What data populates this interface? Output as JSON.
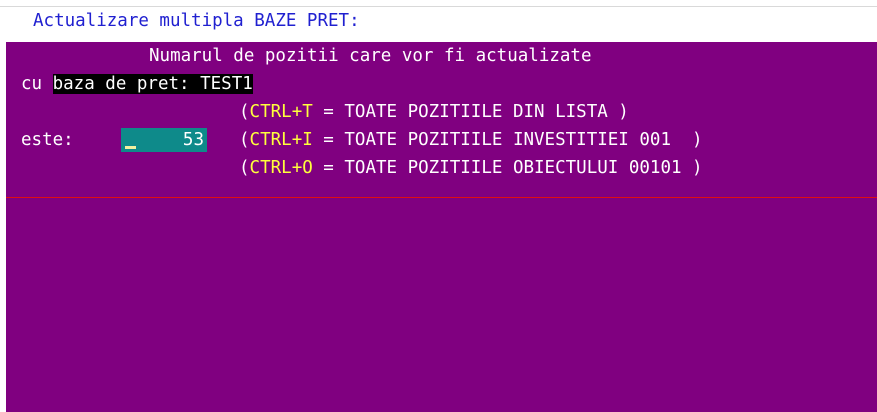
{
  "window": {
    "title": "Actualizare multipla BAZE PRET:"
  },
  "dialog": {
    "heading": "Numarul de pozitii care vor fi actualizate",
    "prefix_cu": "cu ",
    "base_label": "baza de pret: TEST1",
    "label_este": "este:",
    "count_value": "53",
    "options": [
      {
        "open": "(",
        "key": "CTRL+T",
        "rest": " = TOATE POZITIILE DIN LISTA )"
      },
      {
        "open": "(",
        "key": "CTRL+I",
        "rest": " = TOATE POZITIILE INVESTITIEI 001  )"
      },
      {
        "open": "(",
        "key": "CTRL+O",
        "rest": " = TOATE POZITIILE OBIECTULUI 00101 )"
      }
    ]
  },
  "colors": {
    "panel_bg": "#800080",
    "title_text": "#2020d0",
    "key_highlight": "#ffff3c",
    "field_bg": "#0e8a8a",
    "separator": "#e01010"
  }
}
